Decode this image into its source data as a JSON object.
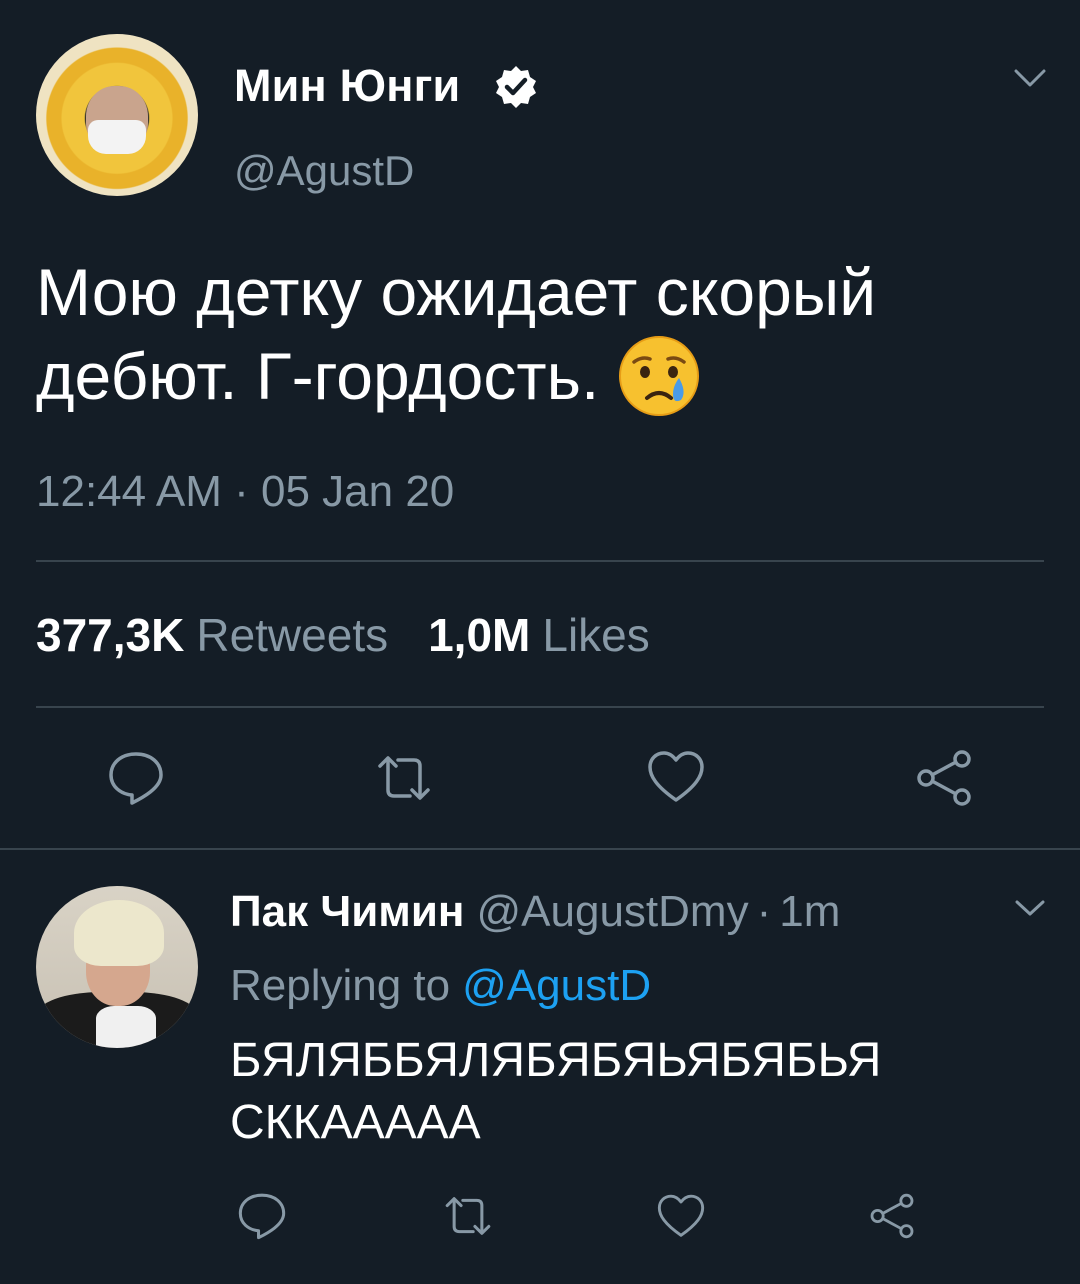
{
  "main_tweet": {
    "author": {
      "display_name": "Мин Юнги",
      "handle": "@AgustD",
      "verified": true
    },
    "text_lines": [
      "Мою детку ожидает скорый",
      "дебют. Г-гордость."
    ],
    "emoji": "crying-face-emoji",
    "timestamp": "12:44 AM · 05 Jan 20",
    "stats": {
      "retweets_value": "377,3K",
      "retweets_label": "Retweets",
      "likes_value": "1,0M",
      "likes_label": "Likes"
    },
    "actions": [
      "reply-icon",
      "retweet-icon",
      "like-icon",
      "share-icon"
    ]
  },
  "reply_tweet": {
    "author": {
      "display_name": "Пак Чимин",
      "handle": "@AugustDmy",
      "separator": "·",
      "time_ago": "1m"
    },
    "replying_to": {
      "label": "Replying to",
      "mention": "@AgustD"
    },
    "text_lines": [
      "БЯЛЯББЯЛЯБЯБЯЬЯБЯБЬЯ",
      "СККААААА"
    ],
    "actions": [
      "reply-icon",
      "retweet-icon",
      "like-icon",
      "share-icon"
    ]
  },
  "colors": {
    "background": "#141d26",
    "secondary_text": "#8899a6",
    "divider": "#38444d",
    "link": "#1da1f2",
    "verified_badge": "#ffffff"
  }
}
